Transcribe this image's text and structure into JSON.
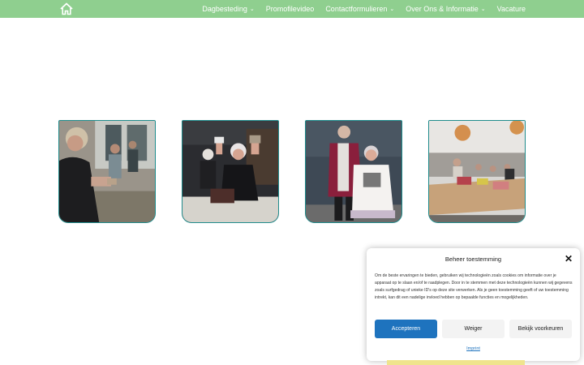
{
  "nav": {
    "items": [
      {
        "label": "Dagbesteding",
        "has_dropdown": true
      },
      {
        "label": "Promofilevideo",
        "has_dropdown": false
      },
      {
        "label": "Contactformulieren",
        "has_dropdown": true
      },
      {
        "label": "Over Ons & Informatie",
        "has_dropdown": true
      },
      {
        "label": "Vacature",
        "has_dropdown": false
      }
    ],
    "chevron": "⌄",
    "icon": "home-icon"
  },
  "consent": {
    "title": "Beheer toestemming",
    "close": "✕",
    "text": "Om de beste ervaringen te bieden, gebruiken wij technologieën zoals cookies om informatie over je apparaat op te slaan en/of te raadplegen. Door in te stemmen met deze technologieën kunnen wij gegevens zoals surfgedrag of unieke ID's op deze site verwerken. Als je geen toestemming geeft of uw toestemming intrekt, kan dit een nadelige invloed hebben op bepaalde functies en mogelijkheden.",
    "accept": "Accepteren",
    "deny": "Weiger",
    "preferences": "Bekijk voorkeuren",
    "imprint": "Imprint"
  },
  "colors": {
    "nav_bg": "#8fcf8f",
    "accent": "#1e73be",
    "photo_border": "#1f8b8b"
  }
}
